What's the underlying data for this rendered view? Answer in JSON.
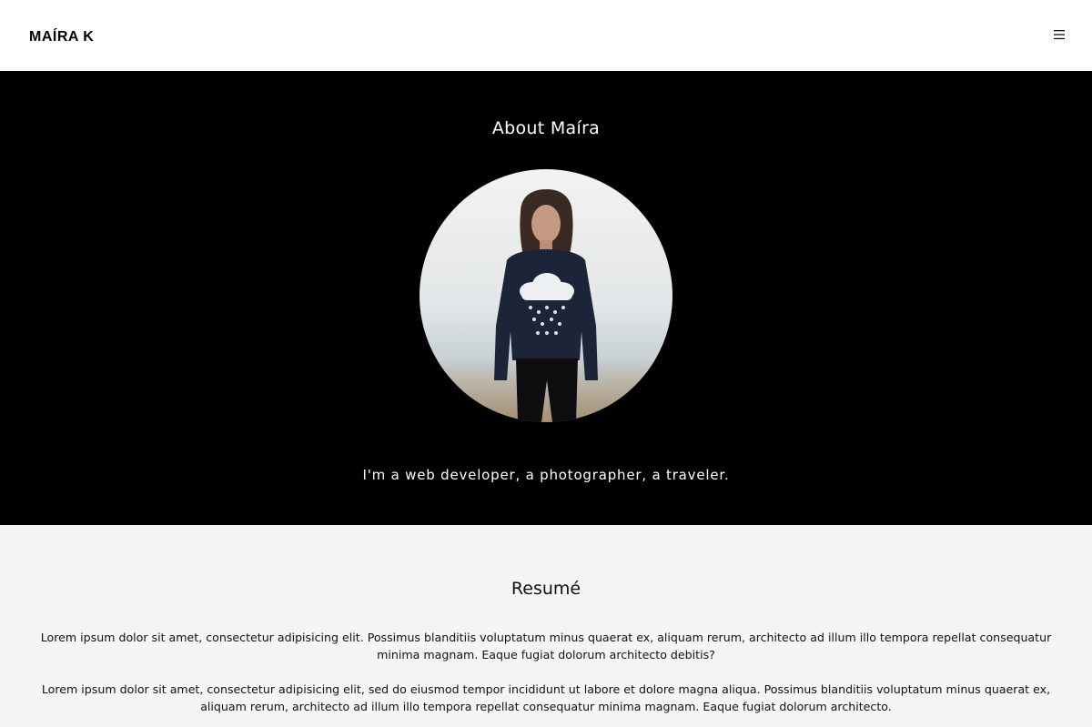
{
  "header": {
    "brand": "MAÍRA K",
    "menu_icon": "hamburger-menu-icon"
  },
  "about": {
    "title": "About Maíra",
    "tagline": "I'm a web developer, a photographer, a traveler.",
    "photo_icon": "profile-photo"
  },
  "resume": {
    "title": "Resumé",
    "paragraphs": [
      "Lorem ipsum dolor sit amet, consectetur adipisicing elit. Possimus blanditiis voluptatum minus quaerat ex, aliquam rerum, architecto ad illum illo tempora repellat consequatur minima magnam. Eaque fugiat dolorum architecto debitis?",
      "Lorem ipsum dolor sit amet, consectetur adipisicing elit, sed do eiusmod tempor incididunt ut labore et dolore magna aliqua. Possimus blanditiis voluptatum minus quaerat ex, aliquam rerum, architecto ad illum illo tempora repellat consequatur minima magnam. Eaque fugiat dolorum architecto."
    ]
  },
  "colors": {
    "header_bg": "#ffffff",
    "about_bg": "#000000",
    "resume_bg": "#f4f5f7",
    "text_dark": "#111111",
    "text_light": "#ffffff"
  }
}
